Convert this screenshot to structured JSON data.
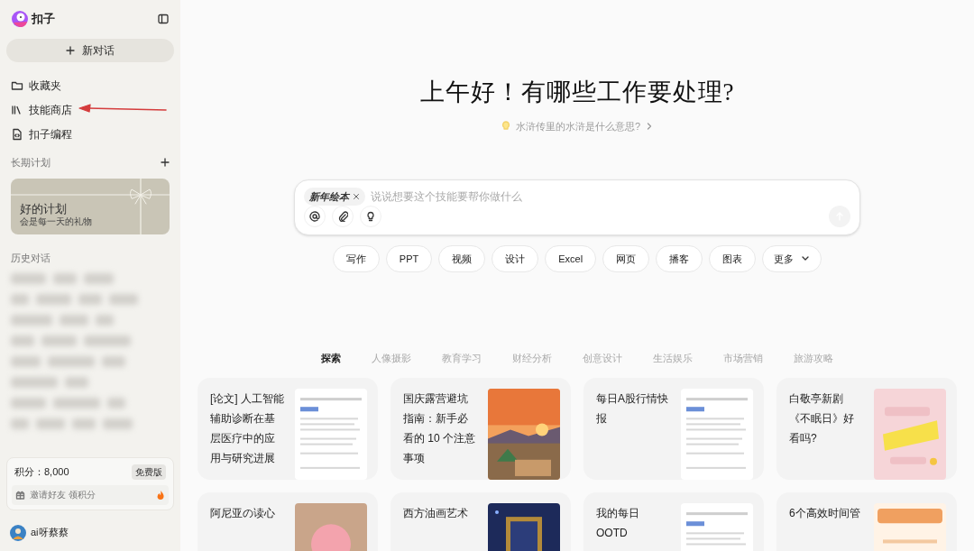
{
  "app": {
    "name": "扣子"
  },
  "new_chat": "新对话",
  "nav": [
    {
      "label": "收藏夹"
    },
    {
      "label": "技能商店"
    },
    {
      "label": "扣子编程"
    }
  ],
  "plans": {
    "title": "长期计划",
    "card": {
      "title": "好的计划",
      "subtitle": "会是每一天的礼物"
    }
  },
  "history": {
    "title": "历史对话"
  },
  "points": {
    "label": "积分：8,000",
    "badge": "免费版",
    "invite": "邀请好友 领积分"
  },
  "user": {
    "name": "ai呀蔡蔡"
  },
  "greeting": "上午好！有哪些工作要处理?",
  "suggestion": "水浒传里的水浒是什么意思?",
  "composer": {
    "skill_tag": "新年绘本",
    "placeholder": "说说想要这个技能要帮你做什么"
  },
  "quick_actions": [
    "写作",
    "PPT",
    "视频",
    "设计",
    "Excel",
    "网页",
    "播客",
    "图表"
  ],
  "more": "更多",
  "tabs": [
    {
      "label": "探索",
      "selected": true
    },
    {
      "label": "人像摄影",
      "selected": false
    },
    {
      "label": "教育学习",
      "selected": false
    },
    {
      "label": "财经分析",
      "selected": false
    },
    {
      "label": "创意设计",
      "selected": false
    },
    {
      "label": "生活娱乐",
      "selected": false
    },
    {
      "label": "市场营销",
      "selected": false
    },
    {
      "label": "旅游攻略",
      "selected": false
    }
  ],
  "cards": [
    {
      "title": "[论文] 人工智能辅助诊断在基层医疗中的应用与研究进展"
    },
    {
      "title": "国庆露营避坑指南：新手必看的 10 个注意事项"
    },
    {
      "title": "每日A股行情快报"
    },
    {
      "title": "白敬亭新剧《不眠日》好看吗?"
    },
    {
      "title": "阿尼亚の读心"
    },
    {
      "title": "西方油画艺术"
    },
    {
      "title": "我的每日OOTD"
    },
    {
      "title": "6个高效时间管"
    }
  ]
}
